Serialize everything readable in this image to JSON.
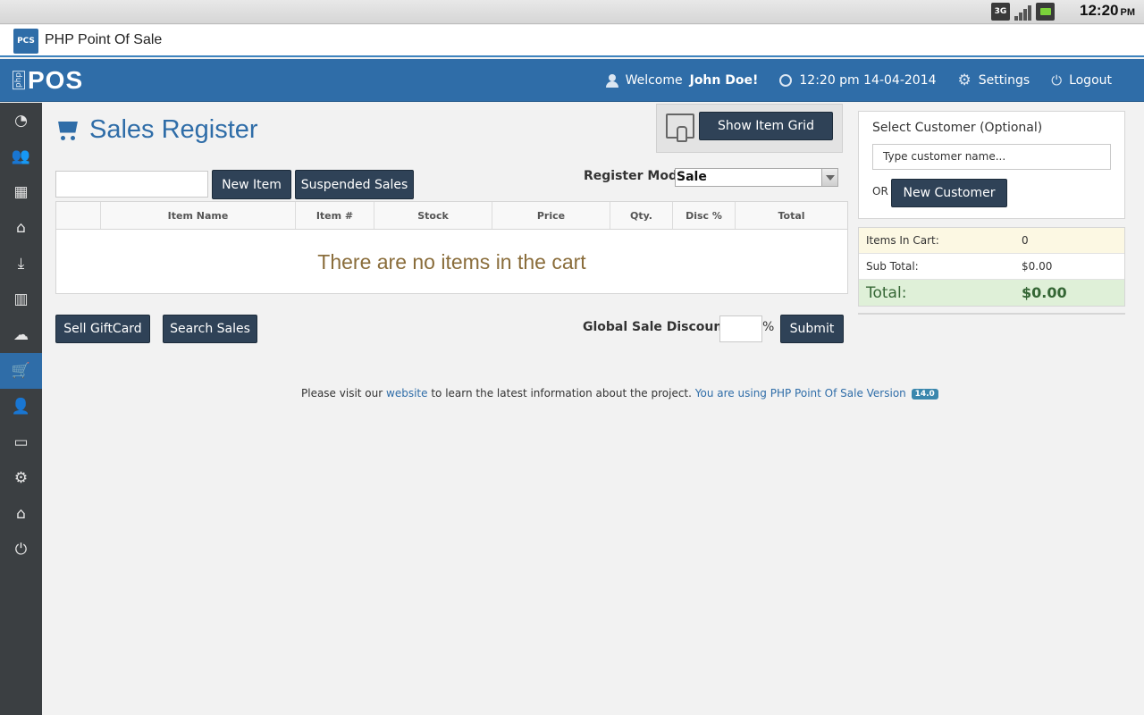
{
  "statusbar": {
    "network": "3G",
    "time": "12:20",
    "ampm": "PM"
  },
  "app": {
    "title": "PHP Point Of Sale",
    "logo_text": "PCS"
  },
  "nav": {
    "brand_php": "php",
    "brand_pos": "POS",
    "welcome_prefix": "Welcome",
    "user_name": "John Doe!",
    "datetime": "12:20 pm 14-04-2014",
    "settings": "Settings",
    "logout": "Logout"
  },
  "sidebar": {
    "items": [
      {
        "icon": "dashboard-icon",
        "glyph": "◔"
      },
      {
        "icon": "customers-icon",
        "glyph": "👥"
      },
      {
        "icon": "items-icon",
        "glyph": "▦"
      },
      {
        "icon": "item-kits-icon",
        "glyph": "⌂"
      },
      {
        "icon": "receivings-icon",
        "glyph": "⤓"
      },
      {
        "icon": "reports-icon",
        "glyph": "▥"
      },
      {
        "icon": "suppliers-icon",
        "glyph": "☁"
      },
      {
        "icon": "sales-icon",
        "glyph": "🛒"
      },
      {
        "icon": "employees-icon",
        "glyph": "👤"
      },
      {
        "icon": "giftcards-icon",
        "glyph": "▭"
      },
      {
        "icon": "config-icon",
        "glyph": "⚙"
      },
      {
        "icon": "locations-icon",
        "glyph": "⌂"
      },
      {
        "icon": "logout-icon",
        "glyph": "⏻"
      }
    ],
    "active_index": 7
  },
  "register": {
    "page_title": "Sales Register",
    "show_item_grid": "Show Item Grid",
    "new_item": "New Item",
    "suspended_sales": "Suspended Sales",
    "register_mode_label": "Register Mode",
    "register_mode_value": "Sale",
    "columns": [
      "",
      "Item Name",
      "Item #",
      "Stock",
      "Price",
      "Qty.",
      "Disc %",
      "Total"
    ],
    "empty_message": "There are no items in the cart",
    "sell_giftcard": "Sell GiftCard",
    "search_sales": "Search Sales",
    "global_discount_label": "Global Sale Discount:",
    "percent_sign": "%",
    "submit": "Submit"
  },
  "footer": {
    "text_before": "Please visit our",
    "link_website": "website",
    "text_after": "to learn the latest information about the project.",
    "version_text": "You are using PHP Point Of Sale Version",
    "version": "14.0"
  },
  "customer": {
    "label": "Select Customer (Optional)",
    "placeholder": "Type customer name...",
    "or": "OR",
    "new_customer": "New Customer"
  },
  "totals": {
    "items_in_cart_label": "Items In Cart:",
    "items_in_cart_value": "0",
    "subtotal_label": "Sub Total:",
    "subtotal_value": "$0.00",
    "total_label": "Total:",
    "total_value": "$0.00"
  }
}
